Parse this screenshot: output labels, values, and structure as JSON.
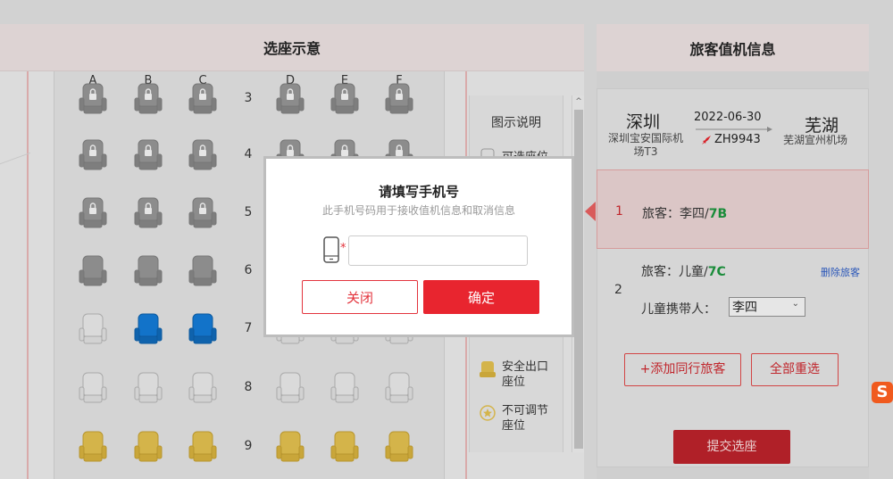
{
  "seat_panel": {
    "title": "选座示意",
    "columns": [
      "A",
      "B",
      "C",
      "D",
      "E",
      "F"
    ],
    "rows": [
      {
        "number": "3",
        "seats": [
          "locked",
          "locked",
          "locked",
          "locked",
          "locked",
          "locked"
        ]
      },
      {
        "number": "4",
        "seats": [
          "locked",
          "locked",
          "locked",
          "locked",
          "locked",
          "locked"
        ]
      },
      {
        "number": "5",
        "seats": [
          "locked",
          "locked",
          "locked",
          "locked",
          "locked",
          "locked"
        ]
      },
      {
        "number": "6",
        "seats": [
          "occupied",
          "occupied",
          "occupied",
          "occupied",
          "occupied",
          "occupied"
        ]
      },
      {
        "number": "7",
        "seats": [
          "available",
          "selected",
          "selected",
          "available",
          "available",
          "available"
        ]
      },
      {
        "number": "8",
        "seats": [
          "available",
          "available",
          "available",
          "available",
          "available",
          "available"
        ]
      },
      {
        "number": "9",
        "seats": [
          "exit",
          "exit",
          "exit",
          "exit",
          "exit",
          "exit"
        ]
      }
    ]
  },
  "legend": {
    "title": "图示说明",
    "available": "可选座位",
    "exit_line1": "安全出口",
    "exit_line2": "座位",
    "fixed_line1": "不可调节",
    "fixed_line2": "座位"
  },
  "checkin_panel": {
    "title": "旅客值机信息",
    "departure_city": "深圳",
    "departure_airport_line1": "深圳宝安国际机",
    "departure_airport_line2": "场T3",
    "date": "2022-06-30",
    "flight_number": "ZH9943",
    "arrival_city": "芜湖",
    "arrival_airport": "芜湖宣州机场",
    "passengers": [
      {
        "index": "1",
        "label": "旅客：李四/",
        "seat": "7B"
      },
      {
        "index": "2",
        "label": "旅客：儿童/",
        "seat": "7C",
        "delete_label": "删除旅客",
        "companion_label": "儿童携带人：",
        "companion_value": "李四"
      }
    ],
    "add_companion_button": "+添加同行旅客",
    "reselect_all_button": "全部重选",
    "submit_button": "提交选座"
  },
  "modal": {
    "title": "请填写手机号",
    "subtitle": "此手机号码用于接收值机信息和取消信息",
    "phone_value": "",
    "required_mark": "*",
    "close_button": "关闭",
    "confirm_button": "确定"
  },
  "colors": {
    "selected_seat": "#1273c9",
    "exit_seat": "#d4b44a",
    "accent_red": "#e8252f",
    "seat_code_green": "#1a8c3a"
  },
  "tray_badge": "S"
}
